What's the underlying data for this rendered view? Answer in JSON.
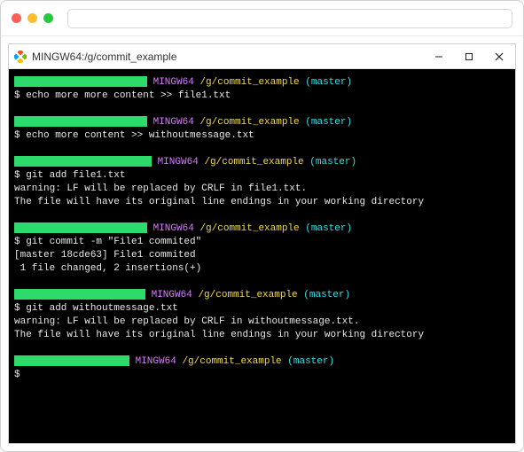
{
  "browser": {
    "url": ""
  },
  "terminal": {
    "title": "MINGW64:/g/commit_example",
    "prompt": {
      "mingw": "MINGW64",
      "path": "/g/commit_example",
      "branch": "(master)"
    },
    "blocks": [
      {
        "user_width": 150,
        "lines": [
          "$ echo more more content >> file1.txt"
        ]
      },
      {
        "user_width": 150,
        "lines": [
          "$ echo more content >> withoutmessage.txt"
        ]
      },
      {
        "user_width": 155,
        "lines": [
          "$ git add file1.txt",
          "warning: LF will be replaced by CRLF in file1.txt.",
          "The file will have its original line endings in your working directory"
        ]
      },
      {
        "user_width": 150,
        "lines": [
          "$ git commit -m \"File1 commited\"",
          "[master 18cde63] File1 commited",
          " 1 file changed, 2 insertions(+)"
        ]
      },
      {
        "user_width": 148,
        "lines": [
          "$ git add withoutmessage.txt",
          "warning: LF will be replaced by CRLF in withoutmessage.txt.",
          "The file will have its original line endings in your working directory"
        ]
      },
      {
        "user_width": 130,
        "lines": [
          "$"
        ]
      }
    ]
  }
}
